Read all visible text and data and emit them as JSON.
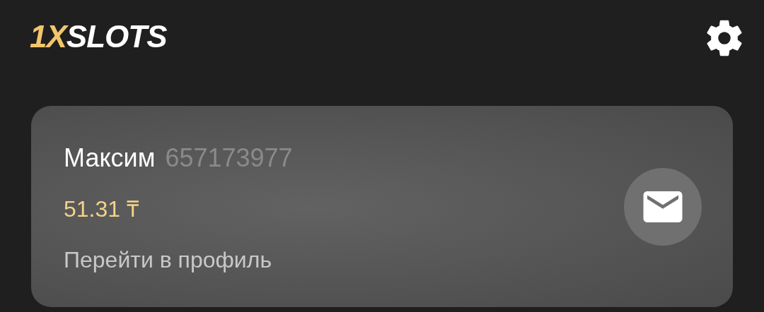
{
  "logo": {
    "prefix": "1X",
    "suffix": "SLOTS"
  },
  "profile_card": {
    "name": "Максим",
    "account_id": "657173977",
    "balance": "51.31 ₸",
    "profile_link": "Перейти в профиль"
  }
}
